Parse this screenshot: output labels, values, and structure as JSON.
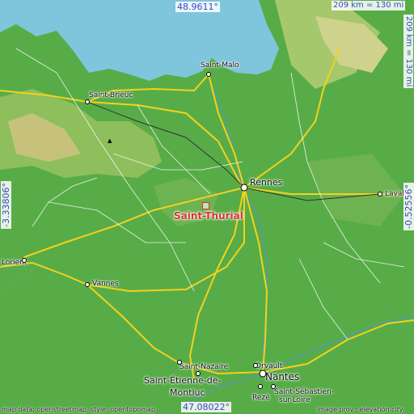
{
  "focus_place": "Saint-Thurial",
  "coordinates": {
    "top": "48.9611°",
    "bottom": "47.08022°",
    "left": "-3.33806°",
    "right": "-0.52556°"
  },
  "scale": {
    "horizontal": "209 km = 130 mi",
    "vertical": "209 km = 130 mi"
  },
  "cities": {
    "saint_malo": "Saint-Malo",
    "saint_brieuc": "Saint-Brieuc",
    "rennes": "Rennes",
    "laval": "Laval",
    "lorient": "Lorient",
    "vannes": "Vannes",
    "saint_nazaire": "Saint-Nazaire",
    "saint_etienne_1": "Saint-Étienne-de-",
    "saint_etienne_2": "Montluc",
    "orvault": "Orvault",
    "nantes": "Nantes",
    "reze": "Rezé",
    "saint_sebastien_1": "Saint-Sébastien-",
    "saint_sebastien_2": "sur-Loire"
  },
  "attribution": {
    "left": "map data: openstreetmap, style: opentopomap",
    "right": "image prov.: elevation.city"
  },
  "colors": {
    "sea": "#7fc5dc",
    "lowland": "#58ac48",
    "upland": "#9cc46a",
    "hills": "#d2c886",
    "roads": "#f2d21c",
    "focus": "#d8342e",
    "coord_text": "#3a46c8"
  },
  "icons": [
    "location-marker-icon",
    "peak-icon"
  ]
}
